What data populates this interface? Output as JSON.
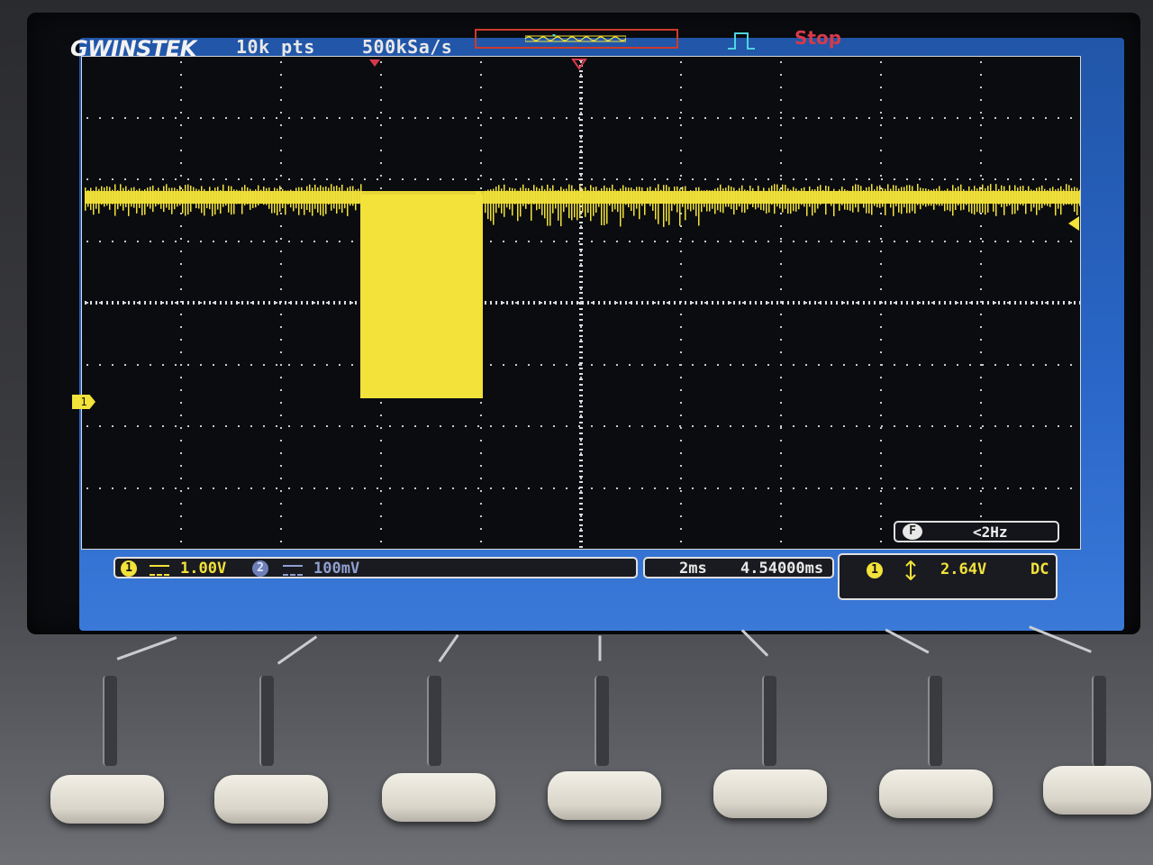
{
  "header": {
    "brand": "GWINSTEK",
    "record_length": "10k pts",
    "sample_rate": "500kSa/s",
    "run_state": "Stop"
  },
  "channel1": {
    "badge": "1",
    "coupling_icon": "dc-coupling-icon",
    "scale": "1.00V",
    "marker": "1"
  },
  "channel2": {
    "badge": "2",
    "coupling_icon": "dc-coupling-icon",
    "scale": "100mV"
  },
  "timebase": {
    "scale": "2ms",
    "position": "4.54000ms"
  },
  "trigger": {
    "source_badge": "1",
    "slope_icon": "trigger-slope-icon",
    "level": "2.64V",
    "coupling": "DC"
  },
  "filter": {
    "badge": "F",
    "value": "<2Hz"
  },
  "colors": {
    "trace_ch1": "#f2e23a",
    "frame_blue": "#2a67c9",
    "stop_red": "#d63a4a"
  }
}
